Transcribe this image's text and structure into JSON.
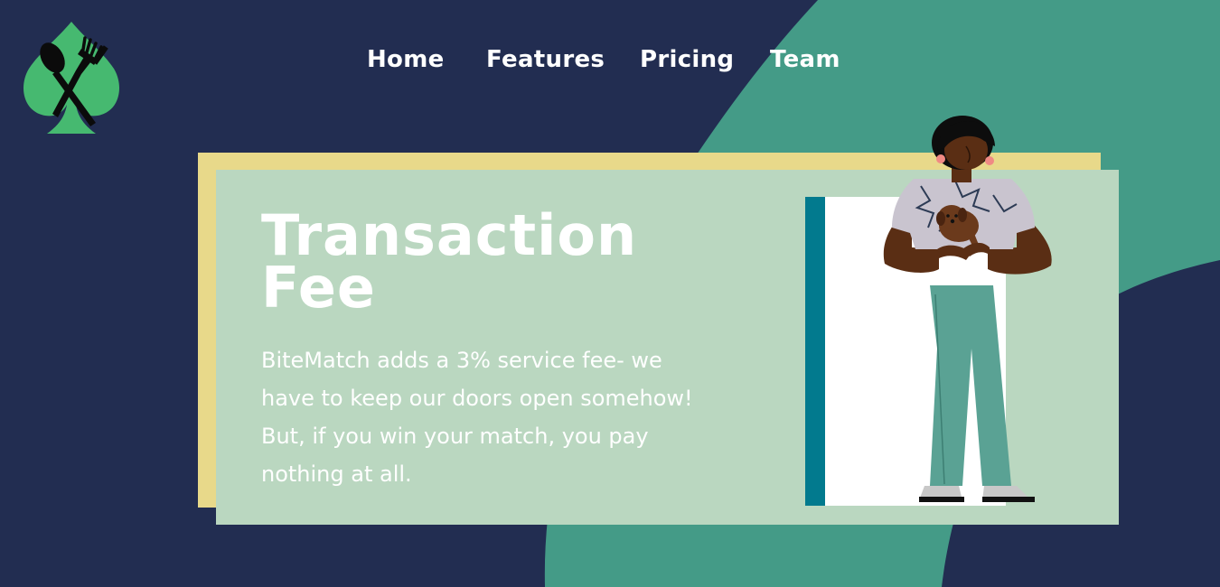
{
  "colors": {
    "background": "#222d51",
    "accent_green": "#449b87",
    "card": "#bad7c0",
    "card_back": "#e8d98a",
    "logo_green": "#46b970",
    "door_frame": "#027a8e"
  },
  "logo": {
    "icon": "spade-utensils-logo"
  },
  "nav": {
    "items": [
      {
        "label": "Home"
      },
      {
        "label": "Features"
      },
      {
        "label": "Pricing"
      },
      {
        "label": "Team"
      }
    ]
  },
  "hero": {
    "title_line1": "Transaction",
    "title_line2": "Fee",
    "body_line1": "BiteMatch adds a 3% service fee- we",
    "body_line2": "have to keep our doors open somehow!",
    "body_line3": "But, if you win your match, you pay",
    "body_line4": "nothing at all.",
    "illustration": "person-holding-puppy-illustration"
  }
}
